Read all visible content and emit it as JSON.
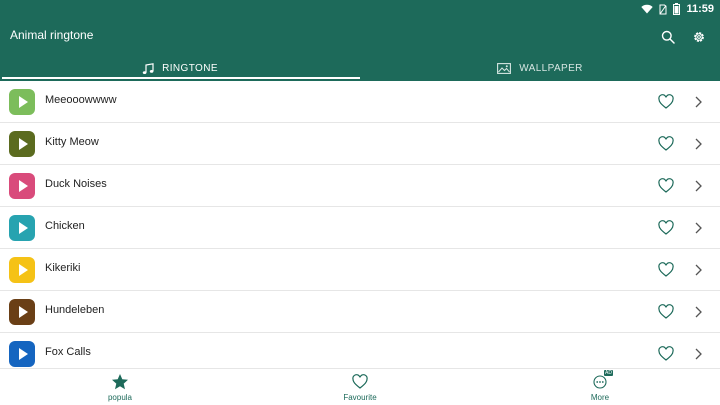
{
  "status_bar": {
    "time": "11:59"
  },
  "app": {
    "title": "Animal ringtone"
  },
  "tabs": [
    {
      "label": "RINGTONE",
      "icon": "music-note-icon",
      "active": true
    },
    {
      "label": "WALLPAPER",
      "icon": "image-icon",
      "active": false
    }
  ],
  "list": {
    "items": [
      {
        "title": "Meeooowwww",
        "color": "#7cbd5b"
      },
      {
        "title": "Kitty Meow",
        "color": "#5b6b1f"
      },
      {
        "title": "Duck Noises",
        "color": "#d94b7b"
      },
      {
        "title": "Chicken",
        "color": "#27a3b0"
      },
      {
        "title": "Kikeriki",
        "color": "#f5c216"
      },
      {
        "title": "Hundeleben",
        "color": "#6a3f16"
      },
      {
        "title": "Fox Calls",
        "color": "#1565c0"
      }
    ]
  },
  "bottom_nav": {
    "items": [
      {
        "label": "popula",
        "icon": "star-icon"
      },
      {
        "label": "Favourite",
        "icon": "heart-outline-icon"
      },
      {
        "label": "More",
        "icon": "more-icon",
        "badge": "AD"
      }
    ]
  },
  "colors": {
    "primary": "#1d6a5a",
    "icon_gray": "#555555"
  }
}
